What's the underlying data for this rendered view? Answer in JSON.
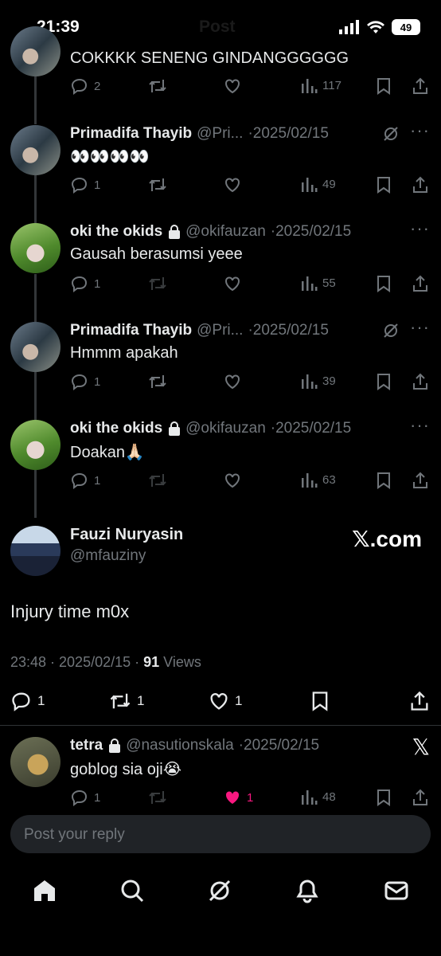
{
  "status_bar": {
    "time": "21:39",
    "title_ghost": "Post",
    "battery": "49"
  },
  "thread": [
    {
      "text": "COKKKK SENENG GINDANGGGGGG",
      "replies": "2",
      "retweets": "",
      "likes": "",
      "views": "117",
      "avatar": "a"
    },
    {
      "name": "Primadifa Thayib",
      "handle": "@Pri...",
      "date": "2025/02/15",
      "text": "👀👀👀👀",
      "replies": "1",
      "retweets": "",
      "likes": "",
      "views": "49",
      "avatar": "a",
      "grok": true
    },
    {
      "name": "oki the okids",
      "handle": "@okifauzan",
      "date": "2025/02/15",
      "text": "Gausah berasumsi yeee",
      "replies": "1",
      "retweets": "",
      "likes": "",
      "views": "55",
      "avatar": "b",
      "lock": true
    },
    {
      "name": "Primadifa Thayib",
      "handle": "@Pri...",
      "date": "2025/02/15",
      "text": "Hmmm apakah",
      "replies": "1",
      "retweets": "",
      "likes": "",
      "views": "39",
      "avatar": "a",
      "grok": true
    },
    {
      "name": "oki the okids",
      "handle": "@okifauzan",
      "date": "2025/02/15",
      "text": "Doakan🙏🏻",
      "replies": "1",
      "retweets": "",
      "likes": "",
      "views": "63",
      "avatar": "b",
      "lock": true
    }
  ],
  "main_tweet": {
    "name": "Fauzi Nuryasin",
    "handle": "@mfauziny",
    "badge": "𝕏.com",
    "text": "Injury time m0x",
    "time": "23:48 · 2025/02/15 · ",
    "views_count": "91",
    "views_label": " Views",
    "replies": "1",
    "retweets": "1",
    "likes": "1"
  },
  "reply": {
    "name": "tetra",
    "handle": "@nasutionskala",
    "date": "2025/02/15",
    "text": "goblog sia oji😭",
    "replies": "1",
    "likes": "1",
    "views": "48",
    "close": "𝕏"
  },
  "composer": {
    "placeholder": "Post your reply"
  },
  "colors": {
    "like_active": "#f91880",
    "muted": "#71767b",
    "text": "#e7e9ea"
  },
  "nav": [
    "home-icon",
    "search-icon",
    "grok-icon",
    "bell-icon",
    "mail-icon"
  ]
}
